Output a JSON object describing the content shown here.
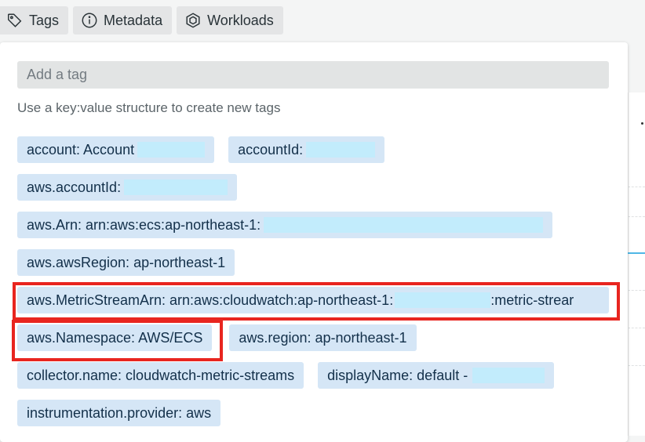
{
  "tabs": [
    {
      "label": "Tags",
      "icon": "tag-icon"
    },
    {
      "label": "Metadata",
      "icon": "info-icon"
    },
    {
      "label": "Workloads",
      "icon": "hexagon-icon"
    }
  ],
  "tag_input": {
    "placeholder": "Add a tag",
    "value": ""
  },
  "hint": "Use a key:value structure to create new tags",
  "tags": {
    "account": "account: Account",
    "accountId": "accountId:",
    "aws_accountId": "aws.accountId:",
    "aws_arn": "aws.Arn: arn:aws:ecs:ap-northeast-1:",
    "aws_region_full": "aws.awsRegion: ap-northeast-1",
    "metric_stream_arn": "aws.MetricStreamArn: arn:aws:cloudwatch:ap-northeast-1:",
    "metric_stream_arn_suffix": ":metric-strear",
    "namespace": "aws.Namespace: AWS/ECS",
    "aws_region": "aws.region: ap-northeast-1",
    "collector": "collector.name: cloudwatch-metric-streams",
    "display_name": "displayName: default -",
    "instrumentation": "instrumentation.provider: aws"
  },
  "colors": {
    "highlight": "#e8251f",
    "chip_bg": "#d5e6f6",
    "redaction": "#c2ecfc"
  }
}
